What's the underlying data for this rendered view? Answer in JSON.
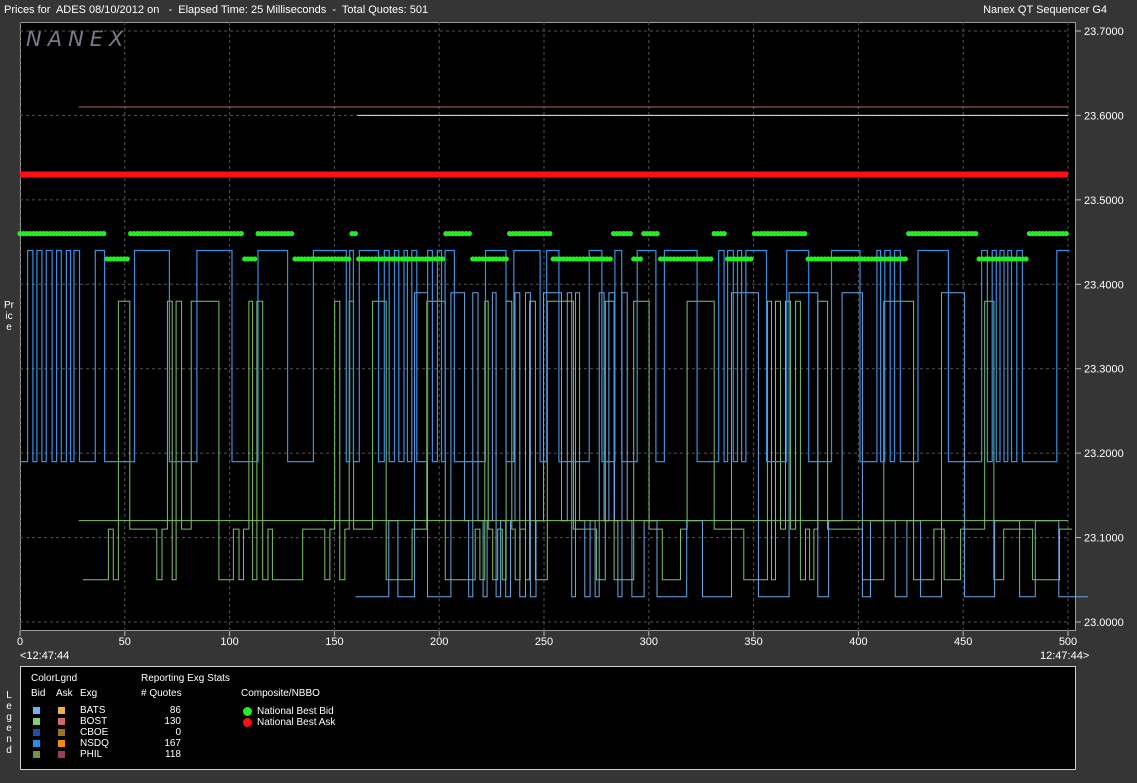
{
  "header": {
    "title_left": "Prices for  ADES 08/10/2012 on   -  Elapsed Time: 25 Milliseconds  -  Total Quotes: 501",
    "title_right": "Nanex QT Sequencer G4"
  },
  "logo_text": "NANEX",
  "side_labels": {
    "price": "Price",
    "legend": "Legend"
  },
  "time_labels": {
    "left": "<12:47:44",
    "right": "12:47:44>"
  },
  "chart_data": {
    "type": "line",
    "title": "Prices for  ADES 08/10/2012 on",
    "xlabel": "",
    "ylabel": "Price",
    "xlim": [
      0,
      500
    ],
    "ylim": [
      23.0,
      23.7
    ],
    "x_ticks": [
      0,
      50,
      100,
      150,
      200,
      250,
      300,
      350,
      400,
      450,
      500
    ],
    "y_ticks": [
      "23.0000",
      "23.1000",
      "23.2000",
      "23.3000",
      "23.4000",
      "23.5000",
      "23.6000",
      "23.7000"
    ],
    "grid": true,
    "levels": {
      "bats_bid": [
        23.19,
        23.44
      ],
      "bost_bid": [
        23.05,
        23.11,
        23.38
      ],
      "nsdq_bid": [
        23.03,
        23.12,
        23.39
      ],
      "nbbo_bid": [
        23.43,
        23.46
      ],
      "nbbo_ask": 23.53
    },
    "series": [
      {
        "name": "National Best Ask",
        "color": "#ff1010",
        "y": 23.53,
        "x_range": [
          0,
          500
        ]
      },
      {
        "name": "National Best Bid",
        "color": "#22ee22",
        "toggle": [
          23.43,
          23.46
        ]
      },
      {
        "name": "BOST ask line",
        "color": "#c06060",
        "y": 23.61,
        "x_range": [
          28,
          500
        ]
      },
      {
        "name": "PHIL ask line",
        "color": "#f0e8d0",
        "y": 23.6,
        "x_range": [
          161,
          500
        ]
      },
      {
        "name": "BATS",
        "color": "#3a8fe0",
        "toggle": [
          23.19,
          23.44
        ]
      },
      {
        "name": "BOST",
        "color": "#7dc46a",
        "toggle": [
          23.05,
          23.11,
          23.38
        ]
      },
      {
        "name": "NSDQ",
        "color": "#6aa8e8",
        "toggle": [
          23.03,
          23.12,
          23.39
        ]
      }
    ]
  },
  "legend": {
    "color_legend_title": "ColorLgnd",
    "col_bid": "Bid",
    "col_ask": "Ask",
    "col_exg": "Exg",
    "stats_title": "Reporting Exg Stats",
    "stats_col": "# Quotes",
    "composite_title": "Composite/NBBO",
    "exchanges": [
      {
        "name": "BATS",
        "quotes": "86",
        "bid_color": "#6ab4f0",
        "ask_color": "#f0b040"
      },
      {
        "name": "BOST",
        "quotes": "130",
        "bid_color": "#7ed07e",
        "ask_color": "#d06a6a"
      },
      {
        "name": "CBOE",
        "quotes": "0",
        "bid_color": "#1f4fa8",
        "ask_color": "#a0701a"
      },
      {
        "name": "NSDQ",
        "quotes": "167",
        "bid_color": "#2090f0",
        "ask_color": "#f08a10"
      },
      {
        "name": "PHIL",
        "quotes": "118",
        "bid_color": "#6a9a3a",
        "ask_color": "#a03a5a"
      }
    ],
    "nbbo": [
      {
        "label": "National Best Bid",
        "color": "#22ee22"
      },
      {
        "label": "National Best Ask",
        "color": "#ff1010"
      }
    ]
  }
}
